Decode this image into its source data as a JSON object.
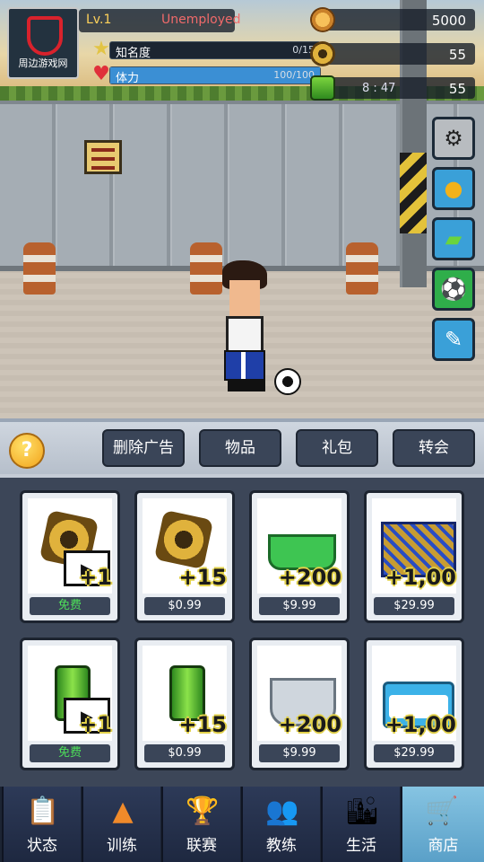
{
  "hud": {
    "logo_text": "周边游戏网",
    "level": "Lv.1",
    "job": "Unemployed",
    "fame": {
      "label": "知名度",
      "value": "0/15",
      "fraction": 0.0
    },
    "stamina": {
      "label": "体力",
      "value": "100/100",
      "fraction": 1.0
    }
  },
  "currencies": {
    "gold": "5000",
    "tokens": "55",
    "energy": "55",
    "energy_timer": "8 : 47"
  },
  "side_buttons": [
    "settings-icon",
    "medal-icon",
    "ticket-icon",
    "soccer-ball-icon",
    "boots-icon"
  ],
  "shop": {
    "help": "?",
    "tabs": [
      "删除广告",
      "物品",
      "礼包",
      "转会"
    ],
    "items": [
      {
        "qty": "+1",
        "price": "免费"
      },
      {
        "qty": "+15",
        "price": "$0.99"
      },
      {
        "qty": "+200",
        "price": "$9.99"
      },
      {
        "qty": "+1,00",
        "price": "$29.99"
      },
      {
        "qty": "+1",
        "price": "免费"
      },
      {
        "qty": "+15",
        "price": "$0.99"
      },
      {
        "qty": "+200",
        "price": "$9.99"
      },
      {
        "qty": "+1,00",
        "price": "$29.99"
      }
    ]
  },
  "nav": [
    {
      "label": "状态"
    },
    {
      "label": "训练"
    },
    {
      "label": "联赛"
    },
    {
      "label": "教练"
    },
    {
      "label": "生活"
    },
    {
      "label": "商店"
    }
  ],
  "colors": {
    "accent": "#3aa0d8",
    "free_text": "#4ee05a",
    "active_tab": "#86c4e2"
  }
}
